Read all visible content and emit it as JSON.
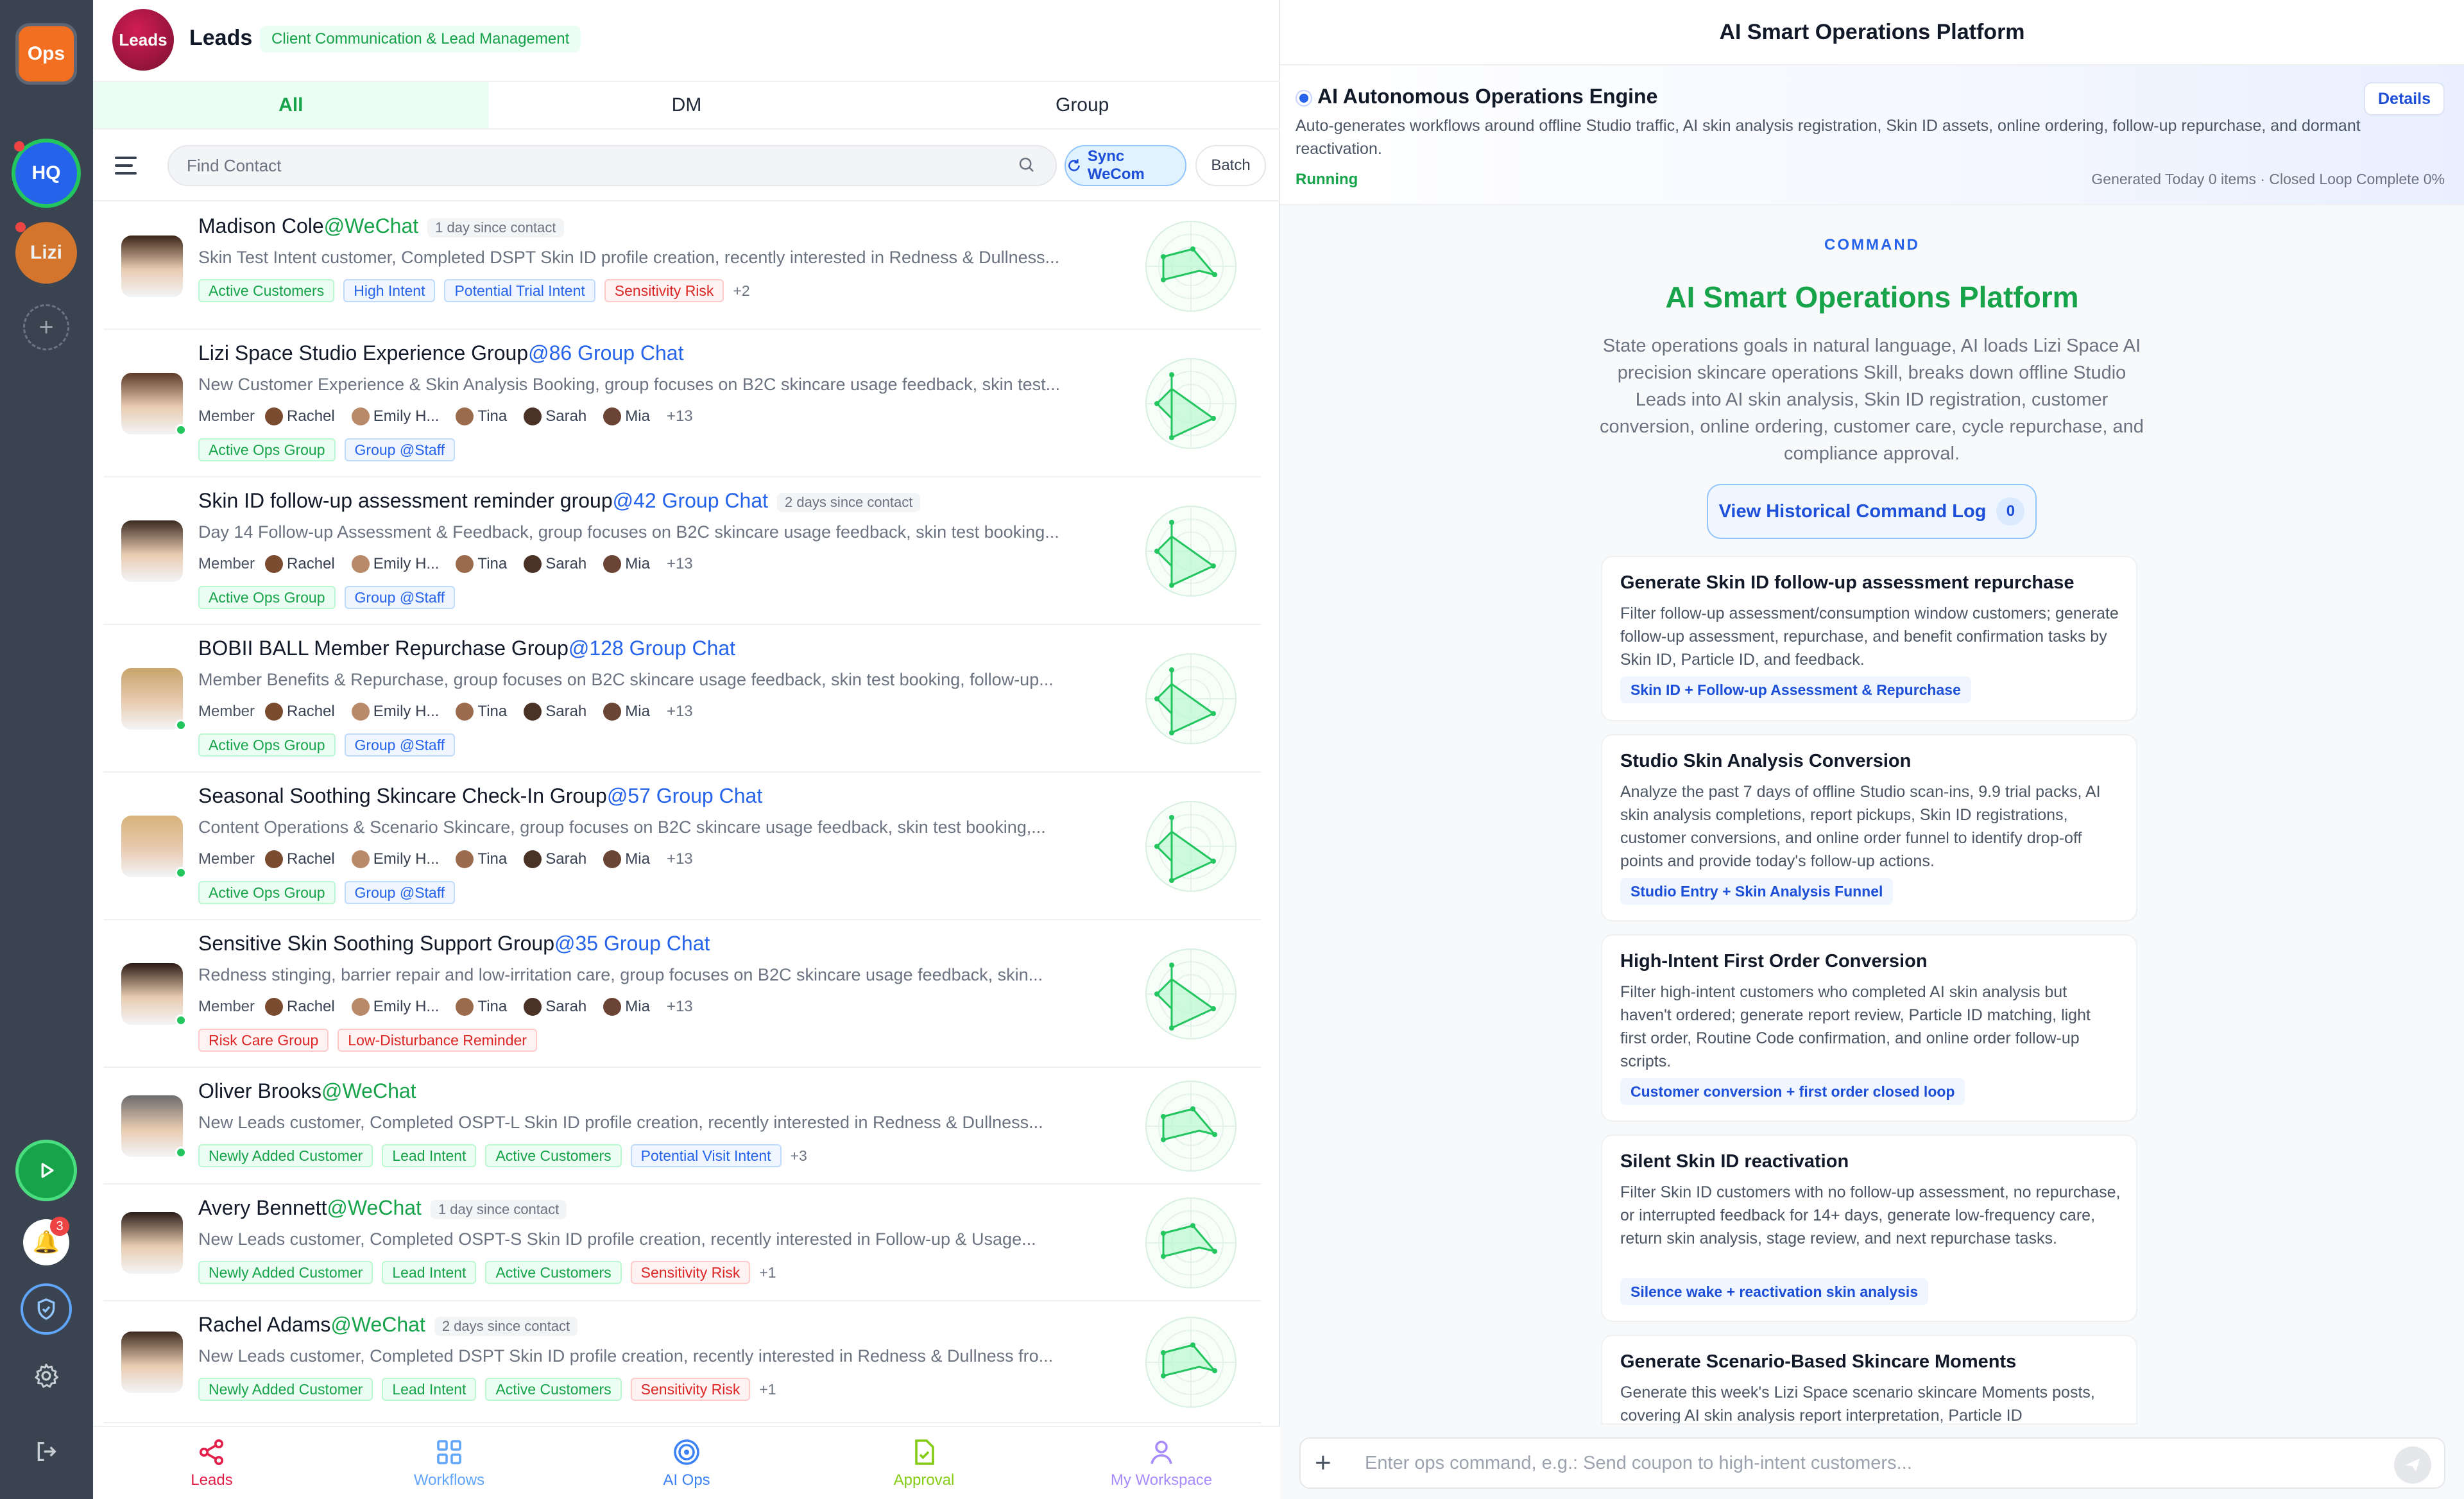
{
  "rail": {
    "ops_label": "Ops",
    "hq_label": "HQ",
    "lizi_label": "Lizi",
    "add_symbol": "+",
    "notification_count": "3"
  },
  "leads": {
    "logo_text": "Leads",
    "title": "Leads",
    "subtitle_tag": "Client Communication & Lead Management",
    "tabs": [
      "All",
      "DM",
      "Group"
    ],
    "search_placeholder": "Find Contact",
    "sync_label": "Sync WeCom",
    "batch_label": "Batch",
    "member_label": "Member",
    "members": [
      "Rachel",
      "Emily H...",
      "Tina",
      "Sarah",
      "Mia"
    ],
    "members_more": "+13",
    "rows": [
      {
        "name": "Madison Cole",
        "suffix": "@WeChat",
        "since": "1 day since contact",
        "desc": "Skin Test Intent customer, Completed DSPT Skin ID profile creation, recently interested in Redness & Dullness...",
        "tags": [
          "Active Customers",
          "High Intent",
          "Potential Trial Intent",
          "Sensitivity Risk"
        ],
        "more": "+2"
      },
      {
        "name": "Lizi Space Studio Experience Group",
        "suffix": "@86 Group Chat",
        "since": "",
        "desc": "New Customer Experience & Skin Analysis Booking, group focuses on B2C skincare usage feedback, skin test...",
        "tags": [
          "Active Ops Group",
          "Group @Staff"
        ],
        "more": ""
      },
      {
        "name": "Skin ID follow-up assessment reminder group",
        "suffix": "@42 Group Chat",
        "since": "2 days since contact",
        "desc": "Day 14 Follow-up Assessment & Feedback, group focuses on B2C skincare usage feedback, skin test booking...",
        "tags": [
          "Active Ops Group",
          "Group @Staff"
        ],
        "more": ""
      },
      {
        "name": "BOBII BALL Member Repurchase Group",
        "suffix": "@128 Group Chat",
        "since": "",
        "desc": "Member Benefits & Repurchase, group focuses on B2C skincare usage feedback, skin test booking, follow-up...",
        "tags": [
          "Active Ops Group",
          "Group @Staff"
        ],
        "more": ""
      },
      {
        "name": "Seasonal Soothing Skincare Check-In Group",
        "suffix": "@57 Group Chat",
        "since": "",
        "desc": "Content Operations & Scenario Skincare, group focuses on B2C skincare usage feedback, skin test booking,...",
        "tags": [
          "Active Ops Group",
          "Group @Staff"
        ],
        "more": ""
      },
      {
        "name": "Sensitive Skin Soothing Support Group",
        "suffix": "@35 Group Chat",
        "since": "",
        "desc": "Redness stinging, barrier repair and low-irritation care, group focuses on B2C skincare usage feedback, skin...",
        "tags": [
          "Risk Care Group",
          "Low-Disturbance Reminder"
        ],
        "more": ""
      },
      {
        "name": "Oliver Brooks",
        "suffix": "@WeChat",
        "since": "",
        "desc": "New Leads customer, Completed OSPT-L Skin ID profile creation, recently interested in Redness & Dullness...",
        "tags": [
          "Newly Added Customer",
          "Lead Intent",
          "Active Customers",
          "Potential Visit Intent"
        ],
        "more": "+3"
      },
      {
        "name": "Avery Bennett",
        "suffix": "@WeChat",
        "since": "1 day since contact",
        "desc": "New Leads customer, Completed OSPT-S Skin ID profile creation, recently interested in Follow-up & Usage...",
        "tags": [
          "Newly Added Customer",
          "Lead Intent",
          "Active Customers",
          "Sensitivity Risk"
        ],
        "more": "+1"
      },
      {
        "name": "Rachel Adams",
        "suffix": "@WeChat",
        "since": "2 days since contact",
        "desc": "New Leads customer, Completed DSPT Skin ID profile creation, recently interested in Redness & Dullness fro...",
        "tags": [
          "Newly Added Customer",
          "Lead Intent",
          "Active Customers",
          "Sensitivity Risk"
        ],
        "more": "+1"
      }
    ],
    "bottom_nav": [
      "Leads",
      "Workflows",
      "AI Ops",
      "Approval",
      "My Workspace"
    ]
  },
  "ops": {
    "header_title": "AI Smart Operations Platform",
    "engine": {
      "title": "AI Autonomous Operations Engine",
      "desc": "Auto-generates workflows around offline Studio traffic, AI skin analysis registration, Skin ID assets, online ordering, follow-up repurchase, and dormant reactivation.",
      "status": "Running",
      "stats": "Generated Today 0 items · Closed Loop Complete 0%",
      "details_label": "Details"
    },
    "command_label": "COMMAND",
    "title": "AI Smart Operations Platform",
    "desc": "State operations goals in natural language, AI loads Lizi Space AI precision skincare operations Skill, breaks down offline Studio Leads into AI skin analysis, Skin ID registration, customer conversion, online ordering, customer care, cycle repurchase, and compliance approval.",
    "history_label": "View Historical Command Log",
    "history_count": "0",
    "cards": [
      {
        "title": "Generate Skin ID follow-up assessment repurchase",
        "desc": "Filter follow-up assessment/consumption window customers; generate follow-up assessment, repurchase, and benefit confirmation tasks by Skin ID, Particle ID, and feedback.",
        "tag": "Skin ID + Follow-up Assessment & Repurchase"
      },
      {
        "title": "Studio Skin Analysis Conversion",
        "desc": "Analyze the past 7 days of offline Studio scan-ins, 9.9 trial packs, AI skin analysis completions, report pickups, Skin ID registrations, customer conversions, and online order funnel to identify drop-off points and provide today's follow-up actions.",
        "tag": "Studio Entry + Skin Analysis Funnel"
      },
      {
        "title": "High-Intent First Order Conversion",
        "desc": "Filter high-intent customers who completed AI skin analysis but haven't ordered; generate report review, Particle ID matching, light first order, Routine Code confirmation, and online order follow-up scripts.",
        "tag": "Customer conversion + first order closed loop"
      },
      {
        "title": "Silent Skin ID reactivation",
        "desc": "Filter Skin ID customers with no follow-up assessment, no repurchase, or interrupted feedback for 14+ days, generate low-frequency care, return skin analysis, stage review, and next repurchase tasks.",
        "tag": "Silence wake + reactivation skin analysis"
      },
      {
        "title": "Generate Scenario-Based Skincare Moments",
        "desc": "Generate this week's Lizi Space scenario skincare Moments posts, covering AI skin analysis report interpretation, Particle ID",
        "tag": ""
      }
    ],
    "input_placeholder": "Enter ops command, e.g.: Send coupon to high-intent customers..."
  },
  "colors": {
    "accent_green": "#16a34a",
    "accent_blue": "#2563eb",
    "rail_bg": "#3a4450",
    "ops_orange": "#f26f21",
    "leads_red": "#c81e4f"
  }
}
